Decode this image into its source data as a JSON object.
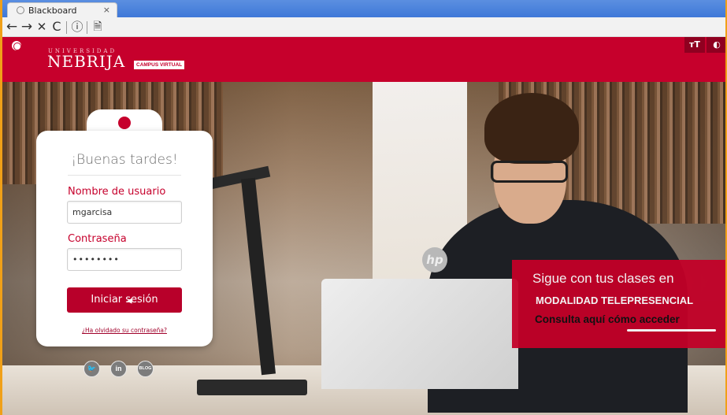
{
  "browser": {
    "tab_title": "Blackboard",
    "tab_close": "×",
    "nav": {
      "back": "←",
      "forward": "→",
      "stop": "✕",
      "reload": "C",
      "info": "ⓘ",
      "page": "🗎"
    }
  },
  "header": {
    "logo_top": "UNIVERSIDAD",
    "logo_main": "NEBRIJA",
    "campus_badge": "CAMPUS VIRTUAL",
    "text_size_button": "тT",
    "contrast_button": "◐"
  },
  "login": {
    "greeting": "¡Buenas tardes!",
    "username_label": "Nombre de usuario",
    "username_value": "mgarcisa",
    "password_label": "Contraseña",
    "password_value": "••••••••",
    "submit_label": "Iniciar sesión",
    "forgot_link": "¿Ha olvidado su contraseña?"
  },
  "social": [
    {
      "icon": "twitter-icon",
      "glyph": "🐦"
    },
    {
      "icon": "linkedin-icon",
      "glyph": "in"
    },
    {
      "icon": "blog-icon",
      "glyph": "BLOG"
    }
  ],
  "promo": {
    "line1": "Sigue con tus clases en",
    "line2": "MODALIDAD TELEPRESENCIAL",
    "line3": "Consulta aquí cómo acceder"
  },
  "colors": {
    "brand_red": "#c6002c",
    "dark_red": "#8f0020",
    "chrome_blue": "#3f78d8",
    "frame_orange": "#f0a018"
  }
}
